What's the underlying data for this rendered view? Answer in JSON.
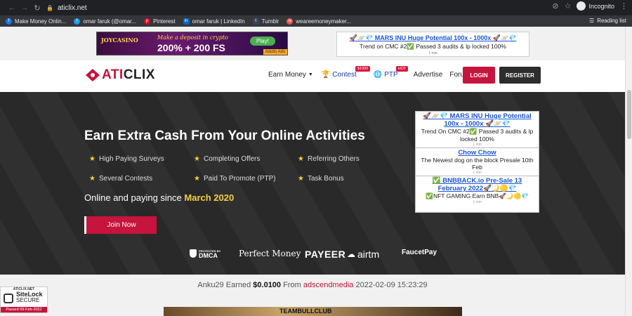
{
  "browser": {
    "url": "aticlix.net",
    "incognito_label": "Incognito",
    "bookmarks": [
      {
        "label": "Make Money Onlin...",
        "color": "#1877f2"
      },
      {
        "label": "omar faruk (@omar...",
        "color": "#1d9bf0"
      },
      {
        "label": "Pinterest",
        "color": "#e60023"
      },
      {
        "label": "omar faruk | LinkedIn",
        "color": "#0a66c2"
      },
      {
        "label": "Tumblr",
        "color": "#35465c"
      },
      {
        "label": "weareemoneymaker...",
        "color": "#e55"
      }
    ],
    "reading_list": "Reading list"
  },
  "ads": {
    "left": {
      "logo": "JOYCASINO",
      "deposit": "Make a deposit in crypto",
      "bonus": "200% + 200 FS",
      "play": "Play!",
      "tag": "Adults Ads"
    },
    "right": {
      "title": "🚀🪐💎 MARS INU Huge Potential 100x - 1000x 🚀🪐💎",
      "sub": "Trend on CMC #2✅ Passed 3 audits & lp locked 100%",
      "tiny": "1 min"
    },
    "stack": [
      {
        "title": "🚀🪐💎 MARS INU Huge Potential 100x - 1000x 🚀🪐💎",
        "desc": "Trend On CMC #2✅ Passed 3 audits & lp locked 100%",
        "tiny": "1 min"
      },
      {
        "title": "Chow Chow",
        "desc": "The Newest dog on the block Presale 10th Feb",
        "tiny": "1 min"
      },
      {
        "title": "✅ BNBBACK.io Pre-Sale 13 February 2022🚀🌙🟡💎",
        "desc": "✅NFT GAMING Earn BNB🚀🌙🟡💎",
        "tiny": "1 min"
      }
    ]
  },
  "header": {
    "logo_red": "ATI",
    "logo_dark": "CLIX",
    "menu": {
      "earn": "Earn Money",
      "contest": "Contest",
      "contest_badge": "$1000",
      "ptp": "PTP",
      "ptp_badge": "HOT",
      "advertise": "Advertise",
      "forum": "Forum"
    },
    "login": "LOGIN",
    "register": "REGISTER"
  },
  "hero": {
    "title": "Earn Extra Cash From Your Online Activities",
    "features": [
      "High Paying Surveys",
      "Completing Offers",
      "Referring Others",
      "Several Contests",
      "Paid To Promote (PTP)",
      "Task Bonus"
    ],
    "since_prefix": "Online and paying since",
    "since_date": "March 2020",
    "join": "Join Now",
    "partners": {
      "dmca": "DMCA",
      "dmca_small": "PROTECTED BY",
      "perfect_money": "Perfect Money",
      "payeer": "PAYEER",
      "airtm": "airtm",
      "faucetpay": "FaucetPay"
    }
  },
  "earned": {
    "user": "Anku29",
    "word": "Earned",
    "amount": "$0.0100",
    "from": "From",
    "source": "adscendmedia",
    "timestamp": "2022-02-09 15:23:29"
  },
  "bottom_banner": "TEAMBULLCLUB",
  "sitelock": {
    "top": "ATICLIX.NET",
    "name": "SiteLock",
    "secure": "SECURE",
    "passed": "Passed 09-Feb-2022"
  }
}
